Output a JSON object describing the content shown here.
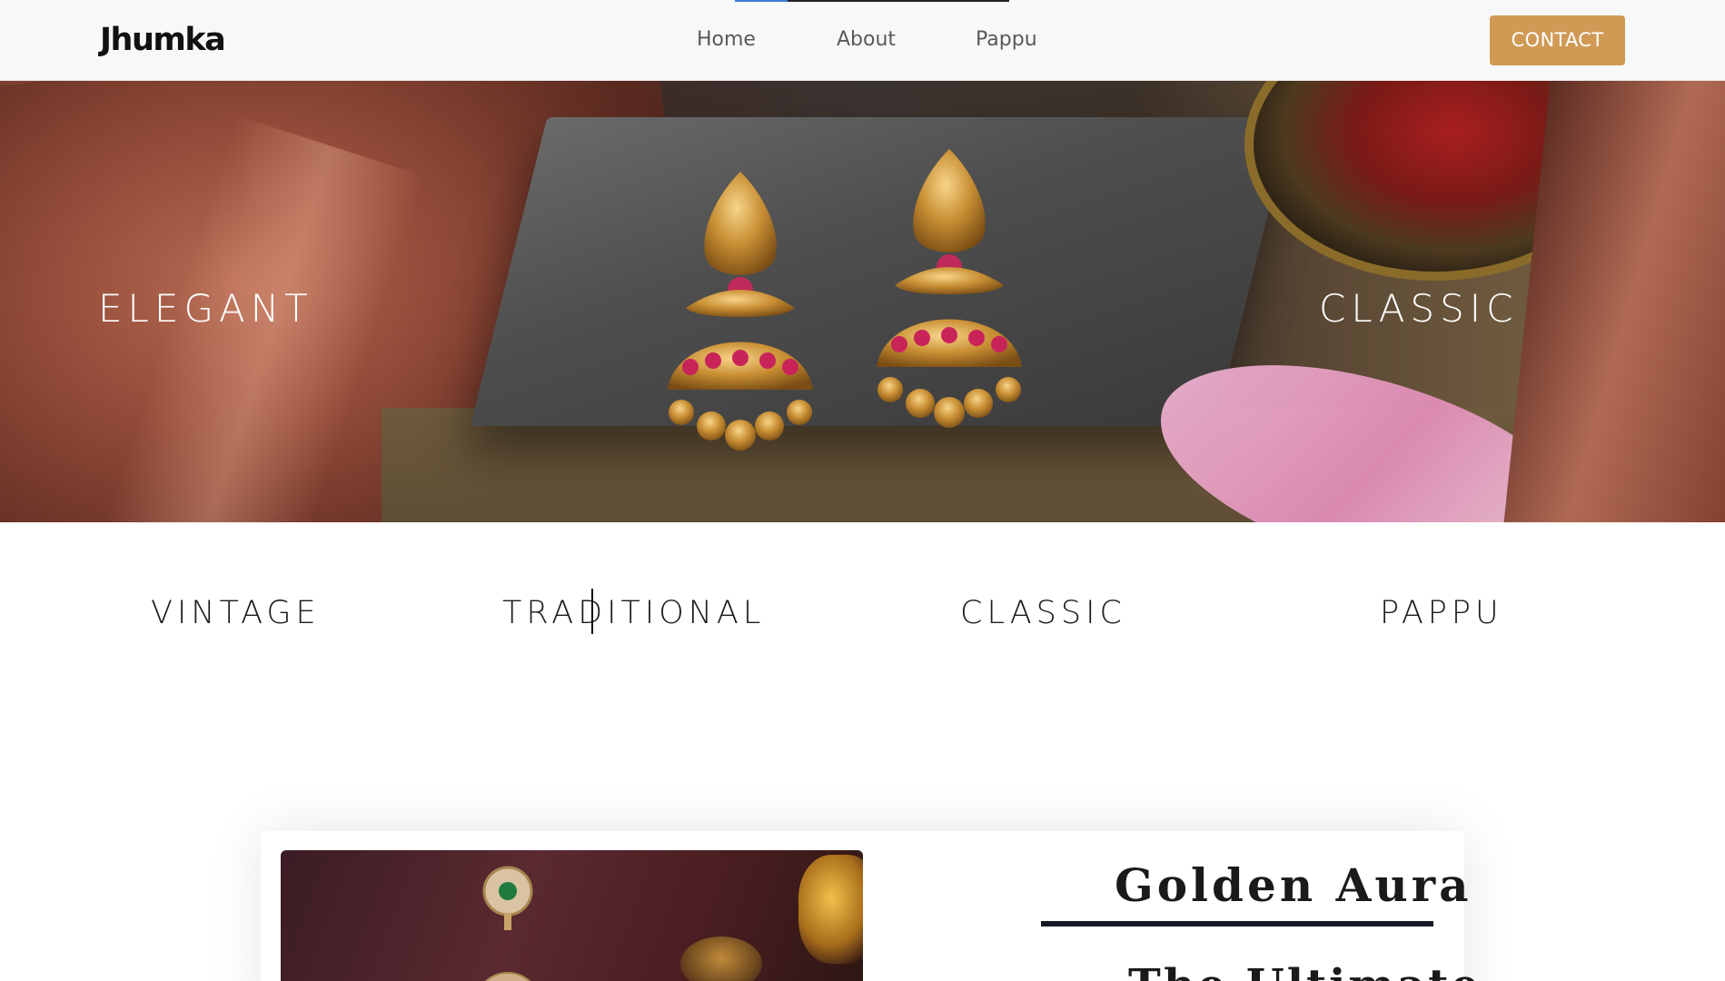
{
  "navbar": {
    "brand": "Jhumka",
    "links": [
      "Home",
      "About",
      "Pappu"
    ],
    "contact_label": "CONTACT",
    "accent_color": "#d09a55"
  },
  "hero": {
    "left_word": "Elegant",
    "right_word": "Classic"
  },
  "styles": [
    "Vintage",
    "Traditional",
    "Classic",
    "Pappu"
  ],
  "card": {
    "title": "Golden Aura",
    "subtitle": "The Ultimate"
  }
}
